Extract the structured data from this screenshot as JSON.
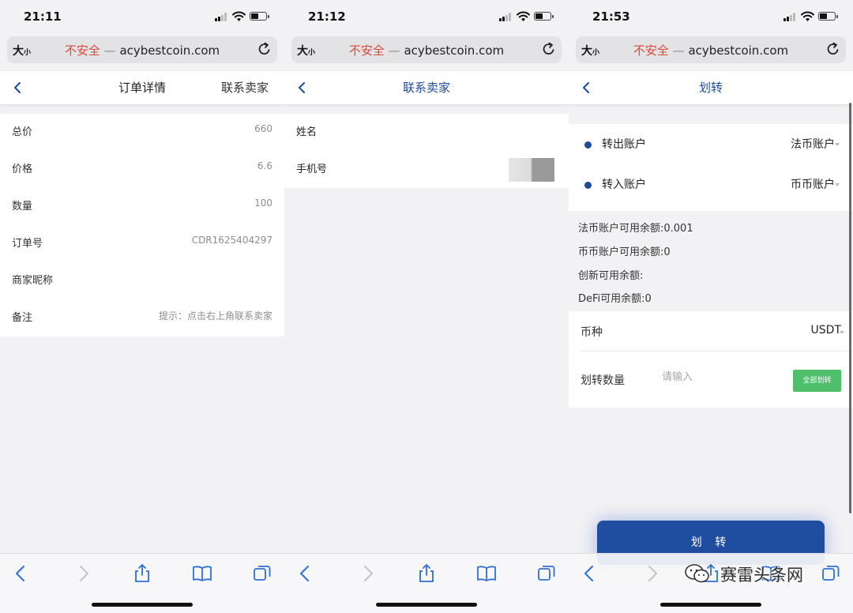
{
  "status": {
    "p1_time": "21:11",
    "p2_time": "21:12",
    "p3_time": "21:53"
  },
  "browser": {
    "text_size": "大",
    "text_size_small": "小",
    "insecure": "不安全",
    "separator": "—",
    "domain": "acybestcoin.com"
  },
  "order_detail": {
    "title": "订单详情",
    "contact_link": "联系卖家",
    "rows": [
      {
        "label": "总价",
        "value": "660"
      },
      {
        "label": "价格",
        "value": "6.6"
      },
      {
        "label": "数量",
        "value": "100"
      },
      {
        "label": "订单号",
        "value": "CDR1625404297"
      },
      {
        "label": "商家昵称",
        "value": ""
      },
      {
        "label": "备注",
        "value": "提示：点击右上角联系卖家"
      }
    ]
  },
  "contact_seller": {
    "title": "联系卖家",
    "name_label": "姓名",
    "phone_label": "手机号"
  },
  "transfer": {
    "title": "划转",
    "out_label": "转出账户",
    "out_value": "法币账户",
    "in_label": "转入账户",
    "in_value": "币币账户",
    "balances": [
      "法币账户可用余额:0.001",
      "币币账户可用余额:0",
      "创新可用余额:",
      "DeFi可用余额:0"
    ],
    "coin_label": "币种",
    "coin_value": "USDT",
    "amount_label": "划转数量",
    "amount_placeholder": "请输入",
    "all_button": "全部划转",
    "submit_button": "划 转"
  },
  "watermark": {
    "text": "赛雷头条网"
  },
  "colors": {
    "accent_blue": "#1e4a9a",
    "insecure_red": "#e0473a",
    "green_button": "#4fbf6b"
  }
}
